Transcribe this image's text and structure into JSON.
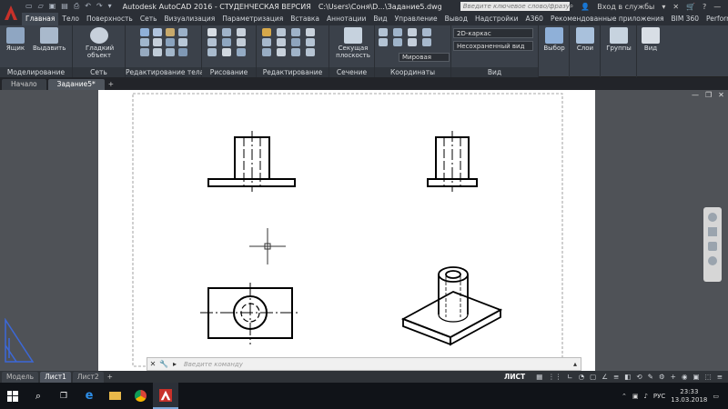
{
  "titlebar": {
    "app_title": "Autodesk AutoCAD 2016 - СТУДЕНЧЕСКАЯ ВЕРСИЯ",
    "file_path": "C:\\Users\\Соня\\D...\\Задание5.dwg",
    "search_placeholder": "Введите ключевое слово/фразу",
    "signin_label": "Вход в службы"
  },
  "ribbon_tabs": [
    "Главная",
    "Тело",
    "Поверхность",
    "Сеть",
    "Визуализация",
    "Параметризация",
    "Вставка",
    "Аннотации",
    "Вид",
    "Управление",
    "Вывод",
    "Надстройки",
    "A360",
    "Рекомендованные приложения",
    "BIM 360",
    "Performance"
  ],
  "ribbon": {
    "box_label": "Ящик",
    "extrude_label": "Выдавить",
    "smooth_label": "Гладкий объект",
    "section_plane_label": "Секущая плоскость",
    "visual_style": "2D-каркас",
    "saved_view": "Несохраненный вид",
    "coord_system": "Мировая",
    "selection_label": "Выбор",
    "layers_label": "Слои",
    "groups_label": "Группы",
    "view_label": "Вид",
    "panels": [
      "Моделирование",
      "Сеть",
      "Редактирование тела",
      "Рисование",
      "Редактирование",
      "Сечение",
      "Координаты",
      "Вид"
    ]
  },
  "file_tabs": {
    "start": "Начало",
    "current": "Задание5*"
  },
  "command_line": {
    "placeholder": "Введите команду"
  },
  "layout_tabs": [
    "Модель",
    "Лист1",
    "Лист2"
  ],
  "status": {
    "space": "ЛИСТ"
  },
  "taskbar": {
    "language": "РУС",
    "time": "23:33",
    "date": "13.03.2018"
  },
  "colors": {
    "accent_red": "#c8312a",
    "ribbon_bg": "#3b414a",
    "paper": "#ffffff",
    "model_bg": "#4f5257"
  }
}
